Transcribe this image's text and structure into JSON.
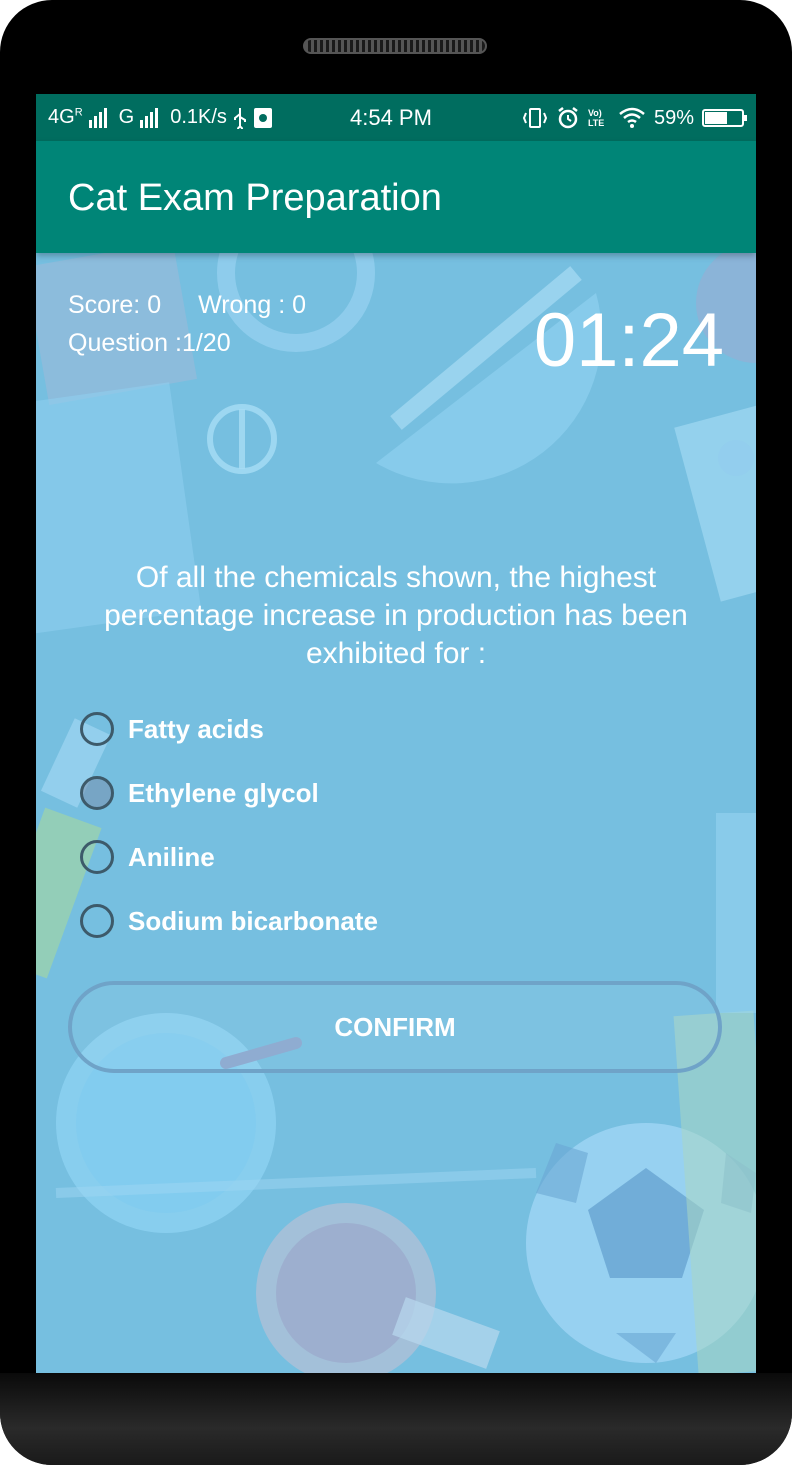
{
  "status_bar": {
    "network_1": "4G",
    "network_1_sup": "R",
    "network_2": "G",
    "speed": "0.1K/s",
    "time": "4:54 PM",
    "volte": "Vo) LTE",
    "battery": "59%",
    "battery_level": 0.59
  },
  "app_bar": {
    "title": "Cat Exam Preparation"
  },
  "quiz": {
    "score": "Score: 0",
    "wrong": "Wrong : 0",
    "question_counter": "Question :1/20",
    "timer": "01:24",
    "question_text": "Of all the chemicals shown, the highest percentage increase in production has been exhibited for :",
    "options": [
      {
        "label": "Fatty acids"
      },
      {
        "label": "Ethylene glycol"
      },
      {
        "label": "Aniline"
      },
      {
        "label": "Sodium bicarbonate"
      }
    ],
    "confirm_label": "CONFIRM"
  },
  "colors": {
    "status_bar": "#006d5f",
    "app_bar": "#008577",
    "background": "#76bfe0"
  },
  "icons": [
    "usb-icon",
    "debug-icon",
    "vibrate-icon",
    "alarm-icon",
    "wifi-icon",
    "battery-icon"
  ]
}
